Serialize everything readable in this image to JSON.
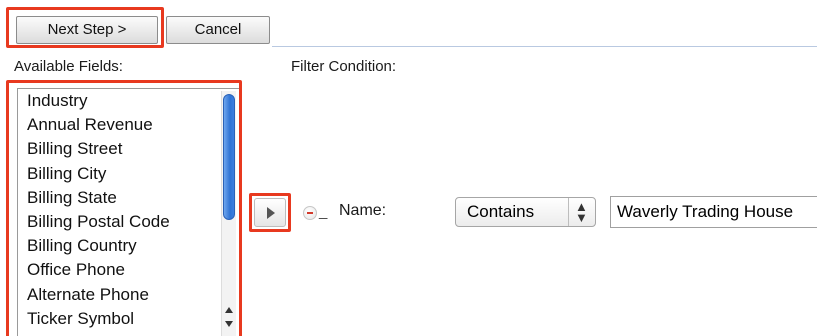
{
  "toolbar": {
    "next_label": "Next Step >",
    "cancel_label": "Cancel"
  },
  "fields": {
    "available_label": "Available Fields:",
    "filter_label": "Filter Condition:",
    "items": [
      "Industry",
      "Annual Revenue",
      "Billing Street",
      "Billing City",
      "Billing State",
      "Billing Postal Code",
      "Billing Country",
      "Office Phone",
      "Alternate Phone",
      "Ticker Symbol"
    ]
  },
  "filter": {
    "remove_mark": "_",
    "field_label": "Name:",
    "operator": "Contains",
    "operator_arrows": "▴▾",
    "value": "Waverly Trading House"
  },
  "colors": {
    "highlight": "#e8391f",
    "scroll_thumb": "#2f73d4"
  },
  "icons": {
    "move": "triangle-right-icon",
    "remove": "minus-circle-icon",
    "select_toggle": "up-down-arrows-icon"
  }
}
